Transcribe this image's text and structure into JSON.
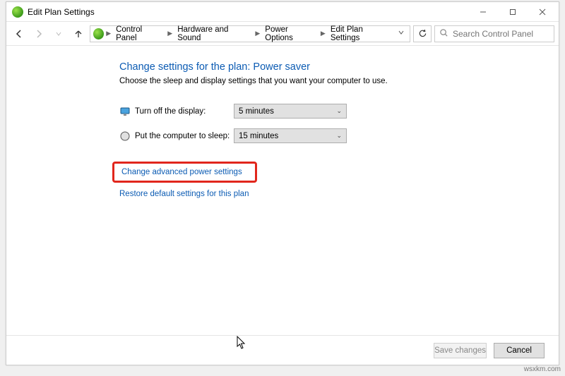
{
  "window": {
    "title": "Edit Plan Settings"
  },
  "breadcrumbs": {
    "items": [
      {
        "label": "Control Panel"
      },
      {
        "label": "Hardware and Sound"
      },
      {
        "label": "Power Options"
      },
      {
        "label": "Edit Plan Settings"
      }
    ]
  },
  "search": {
    "placeholder": "Search Control Panel"
  },
  "main": {
    "heading": "Change settings for the plan: Power saver",
    "subtext": "Choose the sleep and display settings that you want your computer to use.",
    "rows": [
      {
        "label": "Turn off the display:",
        "value": "5 minutes",
        "icon": "monitor"
      },
      {
        "label": "Put the computer to sleep:",
        "value": "15 minutes",
        "icon": "moon"
      }
    ]
  },
  "links": {
    "advanced": "Change advanced power settings",
    "restore": "Restore default settings for this plan"
  },
  "footer": {
    "save": "Save changes",
    "cancel": "Cancel"
  },
  "watermark": "wsxkm.com"
}
